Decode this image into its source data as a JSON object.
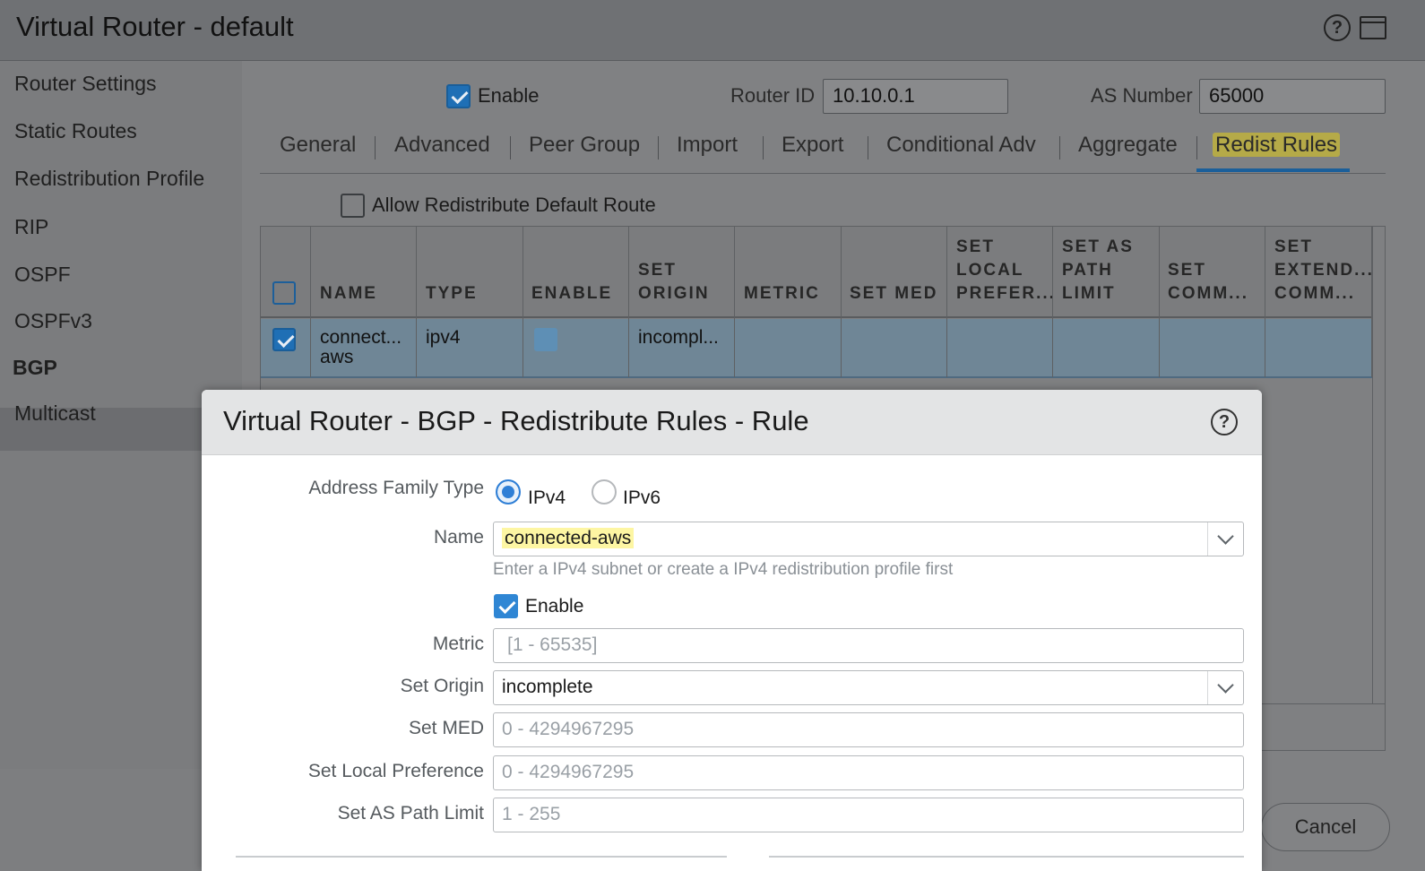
{
  "window": {
    "title": "Virtual Router - default"
  },
  "sidebar": {
    "items": [
      {
        "label": "Router Settings"
      },
      {
        "label": "Static Routes"
      },
      {
        "label": "Redistribution Profile"
      },
      {
        "label": "RIP"
      },
      {
        "label": "OSPF"
      },
      {
        "label": "OSPFv3"
      },
      {
        "label": "BGP",
        "active": true
      },
      {
        "label": "Multicast"
      }
    ]
  },
  "bgp": {
    "enable_label": "Enable",
    "router_id_label": "Router ID",
    "router_id_value": "10.10.0.1",
    "as_number_label": "AS Number",
    "as_number_value": "65000",
    "tabs": [
      {
        "label": "General"
      },
      {
        "label": "Advanced"
      },
      {
        "label": "Peer Group"
      },
      {
        "label": "Import"
      },
      {
        "label": "Export"
      },
      {
        "label": "Conditional Adv"
      },
      {
        "label": "Aggregate"
      },
      {
        "label": "Redist Rules",
        "active": true
      }
    ],
    "allow_default_label": "Allow Redistribute Default Route",
    "table": {
      "headers": {
        "name": "NAME",
        "type": "TYPE",
        "enable": "ENABLE",
        "set_origin_1": "SET",
        "set_origin_2": "ORIGIN",
        "metric": "METRIC",
        "set_med": "SET MED",
        "local_1": "SET",
        "local_2": "LOCAL",
        "local_3": "PREFER...",
        "aspath_1": "SET AS",
        "aspath_2": "PATH",
        "aspath_3": "LIMIT",
        "comm_1": "SET",
        "comm_2": "COMM...",
        "ext_1": "SET",
        "ext_2": "EXTEND...",
        "ext_3": "COMM..."
      },
      "rows": [
        {
          "name_line1": "connect...",
          "name_line2": "aws",
          "type": "ipv4",
          "enabled": true,
          "set_origin": "incompl..."
        }
      ]
    },
    "cancel_label": "Cancel"
  },
  "modal": {
    "title": "Virtual Router - BGP - Redistribute Rules - Rule",
    "address_family_label": "Address Family Type",
    "ipv4_label": "IPv4",
    "ipv6_label": "IPv6",
    "address_family_selected": "IPv4",
    "name_label": "Name",
    "name_value": "connected-aws",
    "name_hint": "Enter a IPv4 subnet or create a IPv4 redistribution profile first",
    "enable_label": "Enable",
    "metric_label": "Metric",
    "metric_placeholder": "[1 - 65535]",
    "set_origin_label": "Set Origin",
    "set_origin_value": "incomplete",
    "set_med_label": "Set MED",
    "set_med_placeholder": "0 - 4294967295",
    "set_local_pref_label": "Set Local Preference",
    "set_local_pref_placeholder": "0 - 4294967295",
    "set_as_path_label": "Set AS Path Limit",
    "set_as_path_placeholder": "1 - 255"
  }
}
